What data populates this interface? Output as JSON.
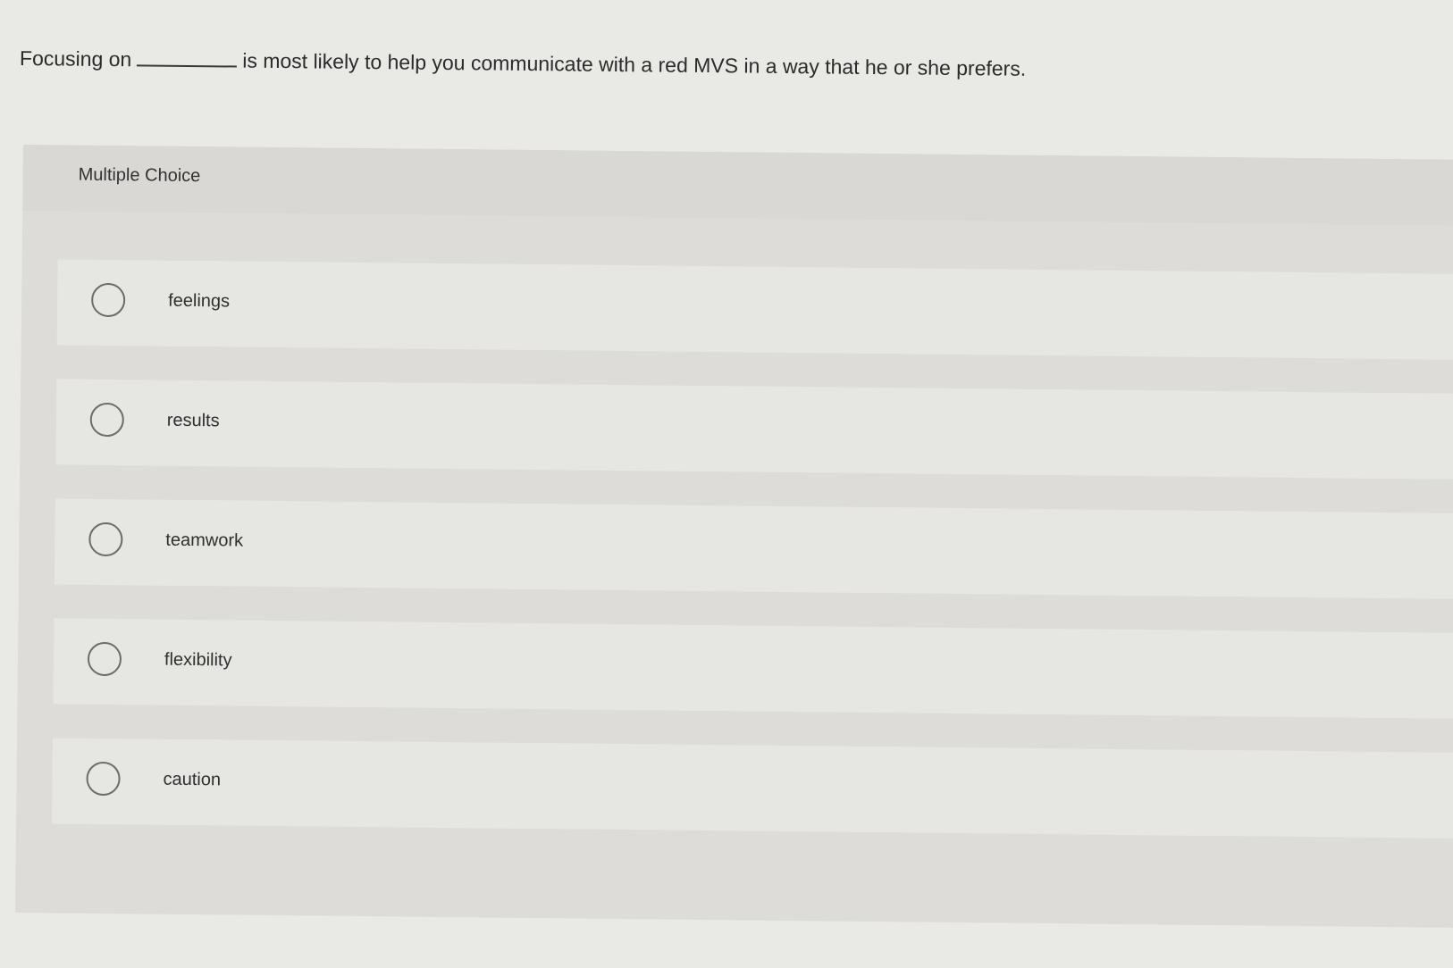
{
  "question": {
    "prefix": "Focusing on",
    "suffix": "is most likely to help you communicate with a red MVS in a way that he or she prefers."
  },
  "multiple_choice": {
    "title": "Multiple Choice",
    "options": [
      {
        "label": "feelings",
        "selected": false
      },
      {
        "label": "results",
        "selected": false
      },
      {
        "label": "teamwork",
        "selected": false
      },
      {
        "label": "flexibility",
        "selected": false
      },
      {
        "label": "caution",
        "selected": false
      }
    ]
  }
}
